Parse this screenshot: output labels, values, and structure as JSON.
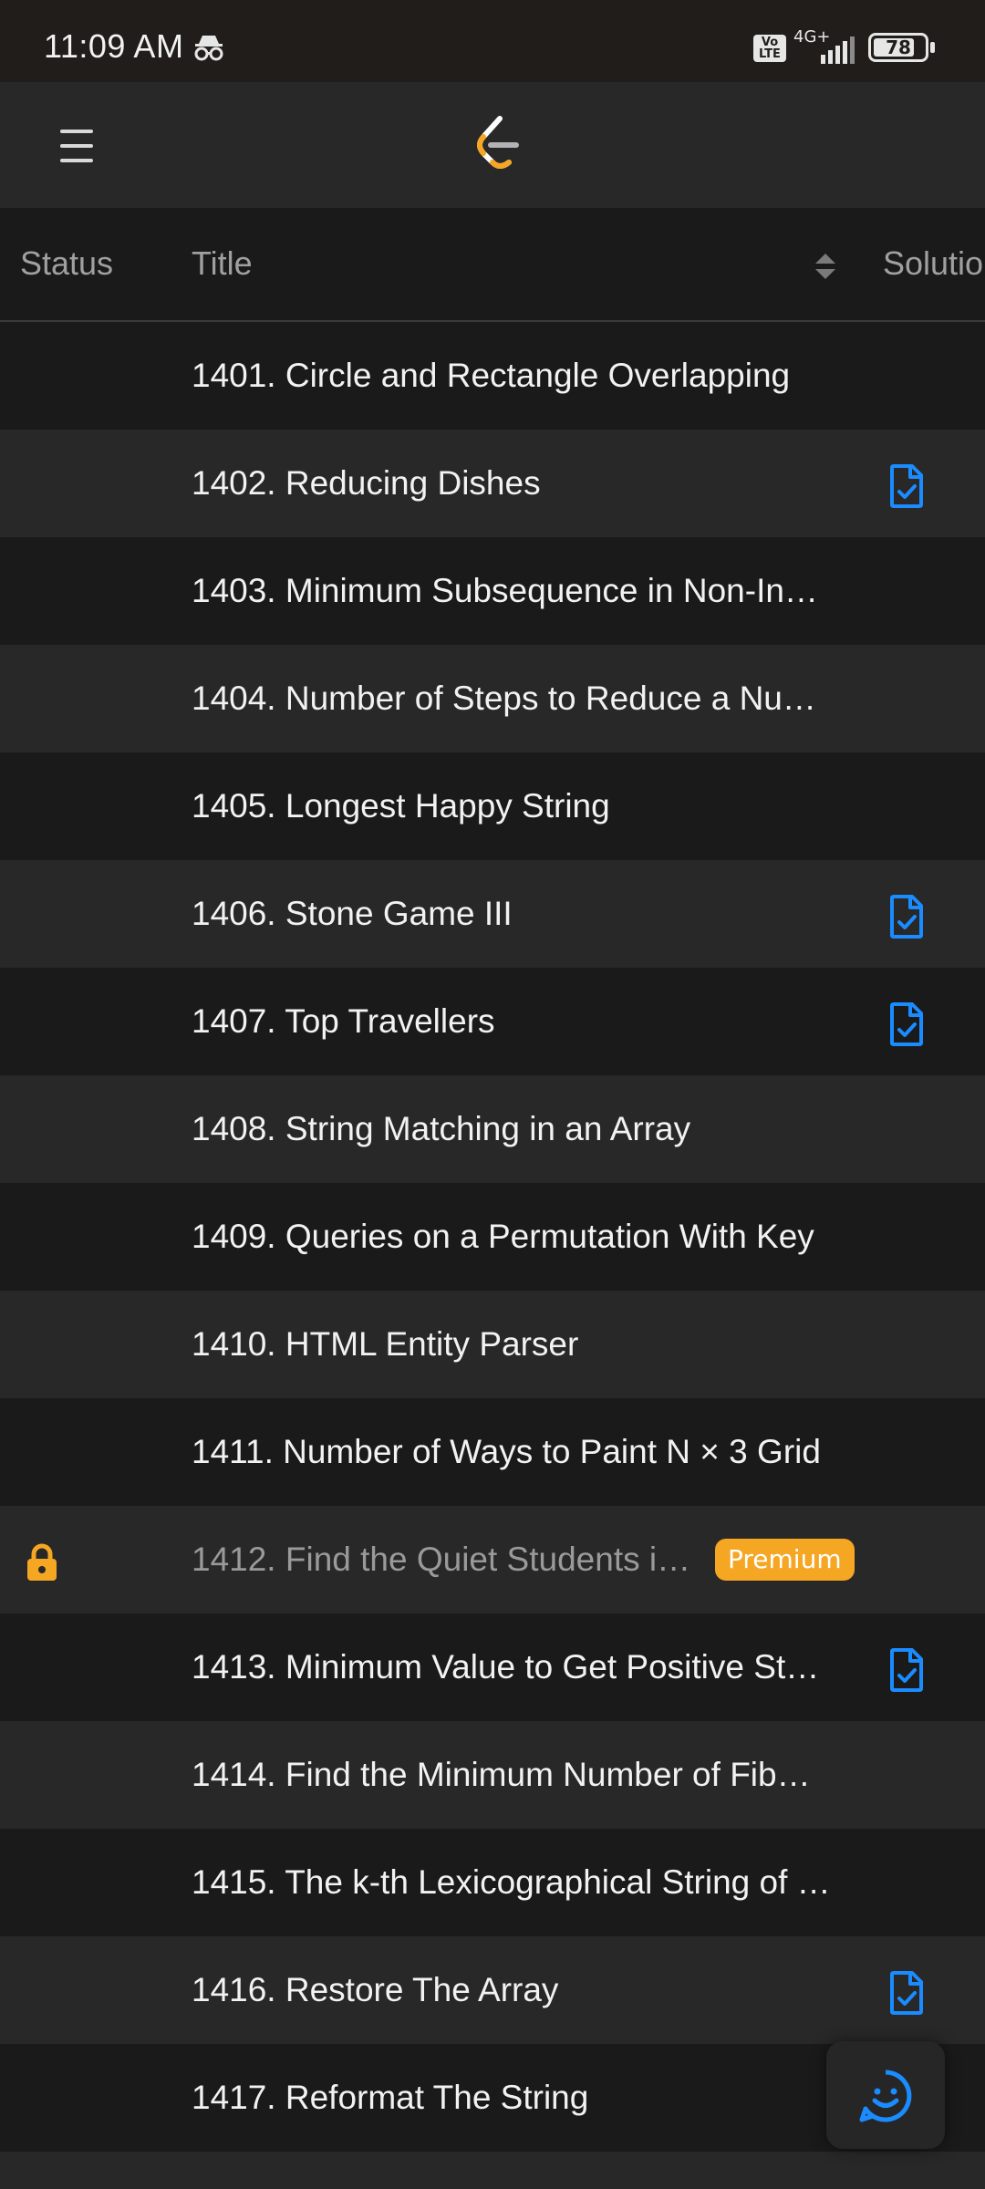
{
  "status_bar": {
    "time": "11:09 AM",
    "volte": "Vo\nLTE",
    "network": "4G+",
    "battery": "78"
  },
  "appbar": {
    "menu_icon": "hamburger-icon",
    "logo_icon": "leetcode-logo"
  },
  "table": {
    "headers": {
      "status": "Status",
      "title": "Title",
      "solution": "Solutio"
    },
    "rows": [
      {
        "title": "1401. Circle and Rectangle Overlapping",
        "solution": false
      },
      {
        "title": "1402. Reducing Dishes",
        "solution": true
      },
      {
        "title": "1403. Minimum Subsequence in Non-In…",
        "solution": false
      },
      {
        "title": "1404. Number of Steps to Reduce a Nu…",
        "solution": false
      },
      {
        "title": "1405. Longest Happy String",
        "solution": false
      },
      {
        "title": "1406. Stone Game III",
        "solution": true
      },
      {
        "title": "1407. Top Travellers",
        "solution": true
      },
      {
        "title": "1408. String Matching in an Array",
        "solution": false
      },
      {
        "title": "1409. Queries on a Permutation With Key",
        "solution": false
      },
      {
        "title": "1410. HTML Entity Parser",
        "solution": false
      },
      {
        "title": "1411. Number of Ways to Paint N × 3 Grid",
        "solution": false
      },
      {
        "title": "1412. Find the Quiet Students i…",
        "solution": false,
        "locked": true,
        "badge": "Premium"
      },
      {
        "title": "1413. Minimum Value to Get Positive St…",
        "solution": true
      },
      {
        "title": "1414. Find the Minimum Number of Fib…",
        "solution": false
      },
      {
        "title": "1415. The k-th Lexicographical String of …",
        "solution": false
      },
      {
        "title": "1416. Restore The Array",
        "solution": true
      },
      {
        "title": "1417. Reformat The String",
        "solution": false
      },
      {
        "title": "",
        "solution": false
      }
    ]
  },
  "colors": {
    "accent_blue": "#1a8cff",
    "premium_orange": "#f5a623",
    "lock_orange": "#f5a623"
  },
  "fab": {
    "icon": "smiley-feedback-icon"
  }
}
